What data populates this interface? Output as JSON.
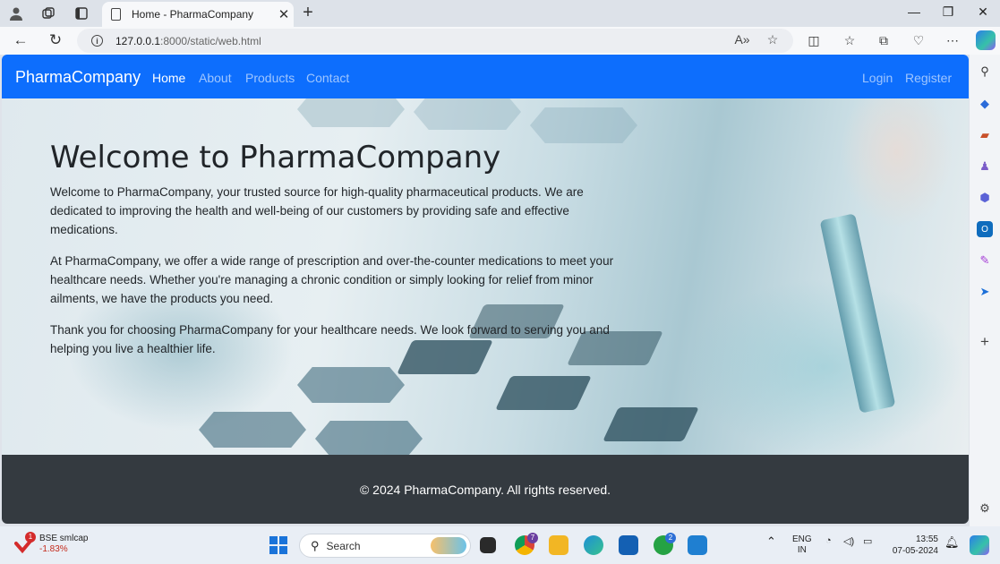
{
  "browser": {
    "tab_title": "Home - PharmaCompany",
    "url_host": "127.0.0.1",
    "url_rest": ":8000/static/web.html"
  },
  "site": {
    "brand": "PharmaCompany",
    "nav": [
      {
        "label": "Home",
        "active": true
      },
      {
        "label": "About",
        "active": false
      },
      {
        "label": "Products",
        "active": false
      },
      {
        "label": "Contact",
        "active": false
      }
    ],
    "auth": [
      "Login",
      "Register"
    ],
    "hero": {
      "title": "Welcome to PharmaCompany",
      "paragraphs": [
        "Welcome to PharmaCompany, your trusted source for high-quality pharmaceutical products. We are dedicated to improving the health and well-being of our customers by providing safe and effective medications.",
        "At PharmaCompany, we offer a wide range of prescription and over-the-counter medications to meet your healthcare needs. Whether you're managing a chronic condition or simply looking for relief from minor ailments, we have the products you need.",
        "Thank you for choosing PharmaCompany for your healthcare needs. We look forward to serving you and helping you live a healthier life."
      ]
    },
    "footer": "© 2024 PharmaCompany. All rights reserved."
  },
  "taskbar": {
    "stock_name": "BSE smlcap",
    "stock_change": "-1.83%",
    "stock_badge": "1",
    "search_label": "Search",
    "chrome_badge": "7",
    "whatsapp_badge": "2",
    "lang_line1": "ENG",
    "lang_line2": "IN",
    "time": "13:55",
    "date": "07-05-2024"
  },
  "colors": {
    "navbar": "#0d6efd",
    "footer": "#343a40"
  }
}
